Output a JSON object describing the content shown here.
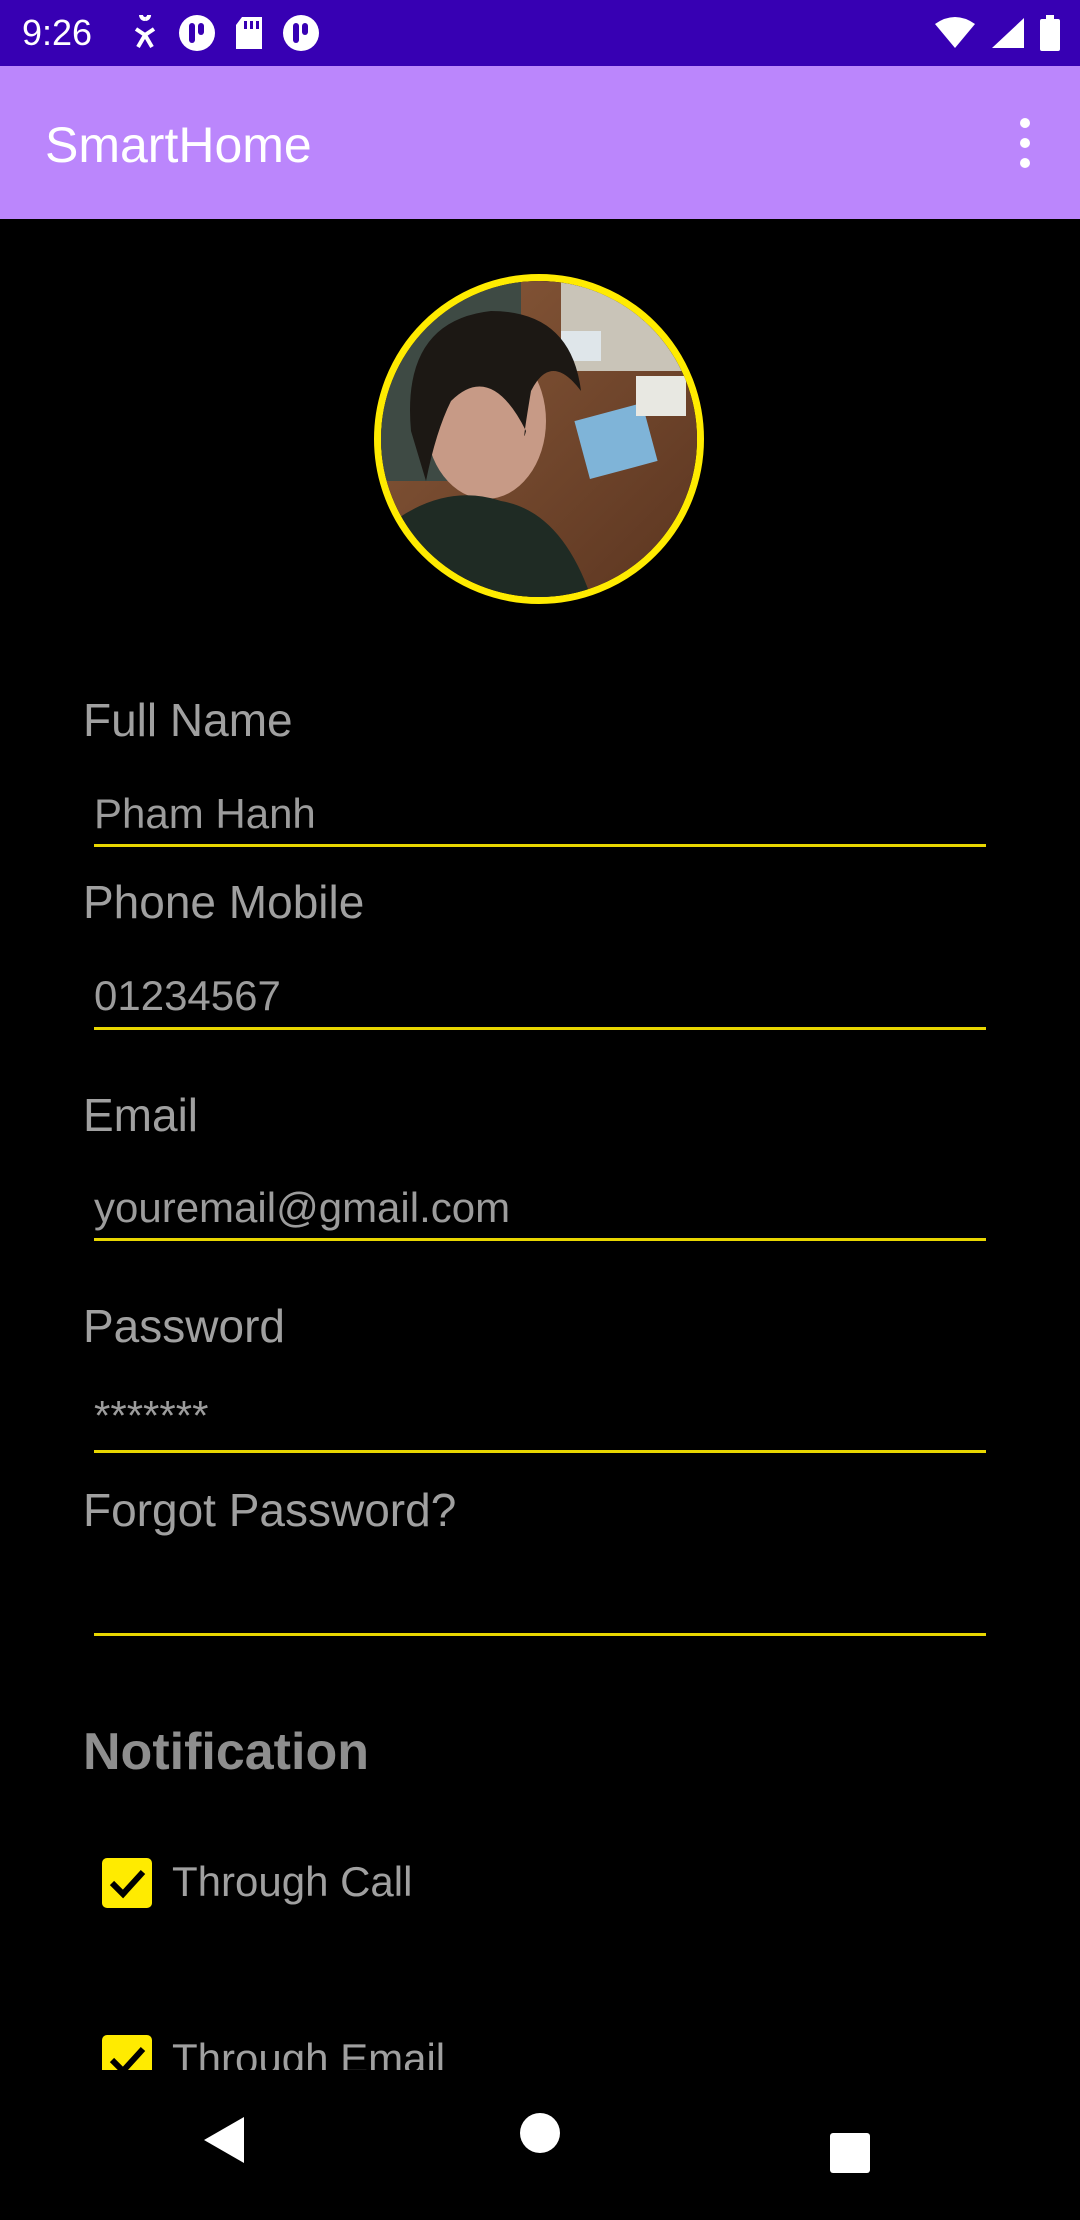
{
  "status_bar": {
    "time": "9:26",
    "left_icons": [
      "accessibility-icon",
      "notification-icon",
      "sd-card-icon",
      "notification-icon"
    ],
    "right_icons": [
      "wifi-icon",
      "signal-icon",
      "battery-icon"
    ]
  },
  "app_bar": {
    "title": "SmartHome",
    "menu_icon": "more-vert-icon"
  },
  "profile": {
    "avatar_border_color": "#ffeb00"
  },
  "form": {
    "full_name": {
      "label": "Full Name",
      "value": "Pham Hanh"
    },
    "phone": {
      "label": "Phone Mobile",
      "value": "01234567"
    },
    "email": {
      "label": "Email",
      "value": "youremail@gmail.com"
    },
    "password": {
      "label": "Password",
      "value": "*******"
    },
    "forgot": {
      "label": "Forgot Password?",
      "value": ""
    }
  },
  "notification": {
    "title": "Notification",
    "options": [
      {
        "label": "Through Call",
        "checked": true
      },
      {
        "label": "Through Email",
        "checked": true
      }
    ]
  },
  "colors": {
    "status_bar": "#3700b3",
    "app_bar": "#bb86fc",
    "accent": "#ffeb00"
  },
  "nav_bar": {
    "icons": [
      "back-icon",
      "home-icon",
      "recents-icon"
    ]
  }
}
